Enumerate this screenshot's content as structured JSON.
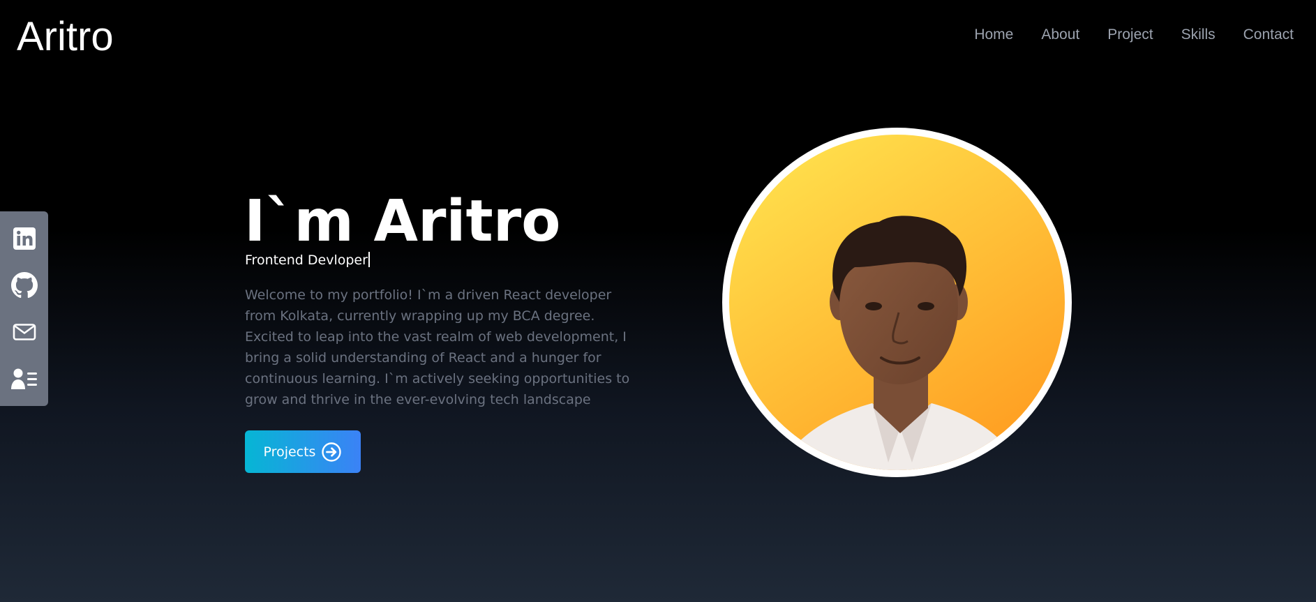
{
  "header": {
    "brand": "Aritro",
    "nav": [
      "Home",
      "About",
      "Project",
      "Skills",
      "Contact"
    ]
  },
  "social": {
    "icons": [
      "linkedin-icon",
      "github-icon",
      "mail-icon",
      "contact-card-icon"
    ]
  },
  "hero": {
    "title": "I`m Aritro",
    "subtitle": "Frontend Devloper",
    "intro": "Welcome to my portfolio! I`m a driven React developer from Kolkata, currently wrapping up my BCA degree. Excited to leap into the vast realm of web development, I bring a solid understanding of React and a hunger for continuous learning. I`m actively seeking opportunities to grow and thrive in the ever-evolving tech landscape",
    "button_label": "Projects",
    "button_icon": "arrow-right-circle-icon"
  },
  "colors": {
    "accent_gradient": [
      "#06b6d4",
      "#3b82f6"
    ],
    "portrait_background": [
      "#ffe14d",
      "#ff9a1f"
    ]
  }
}
